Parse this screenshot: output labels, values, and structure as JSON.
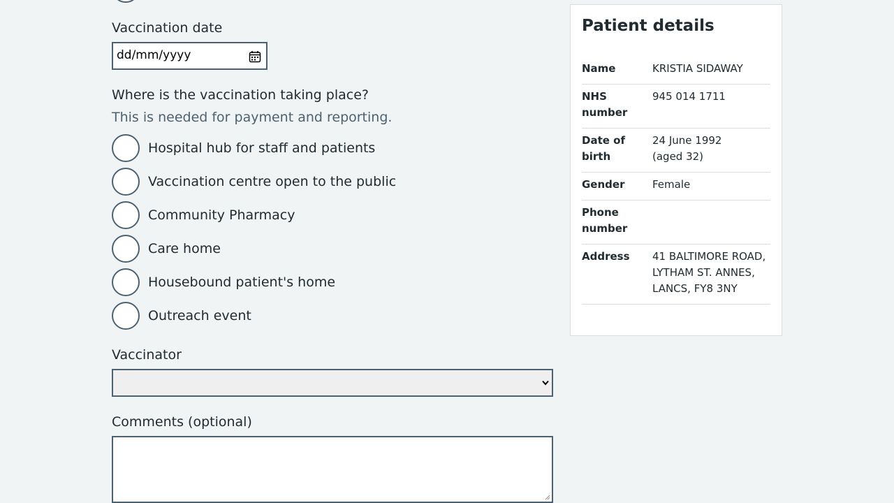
{
  "vaccination_date": {
    "label": "Vaccination date",
    "placeholder": "dd/mm/yyyy"
  },
  "location": {
    "question": "Where is the vaccination taking place?",
    "hint": "This is needed for payment and reporting.",
    "options": [
      "Hospital hub for staff and patients",
      "Vaccination centre open to the public",
      "Community Pharmacy",
      "Care home",
      "Housebound patient's home",
      "Outreach event"
    ]
  },
  "vaccinator": {
    "label": "Vaccinator",
    "selected": ""
  },
  "comments": {
    "label": "Comments (optional)",
    "value": ""
  },
  "patient": {
    "title": "Patient details",
    "rows": [
      {
        "key": "Name",
        "value": "KRISTIA SIDAWAY"
      },
      {
        "key": "NHS number",
        "value": "945 014 1711"
      },
      {
        "key": "Date of birth",
        "value": "24 June 1992\n(aged 32)"
      },
      {
        "key": "Gender",
        "value": "Female"
      },
      {
        "key": "Phone number",
        "value": ""
      },
      {
        "key": "Address",
        "value": "41 BALTIMORE ROAD, LYTHAM ST. ANNES, LANCS, FY8 3NY"
      }
    ]
  },
  "icons": {
    "calendar": "calendar-icon",
    "dropdown": "chevron-down-icon",
    "resize": "resize-grip-icon"
  },
  "colors": {
    "page_bg": "#f0f4f5",
    "border": "#4c6272",
    "text": "#212b32",
    "hint": "#4c6272"
  }
}
